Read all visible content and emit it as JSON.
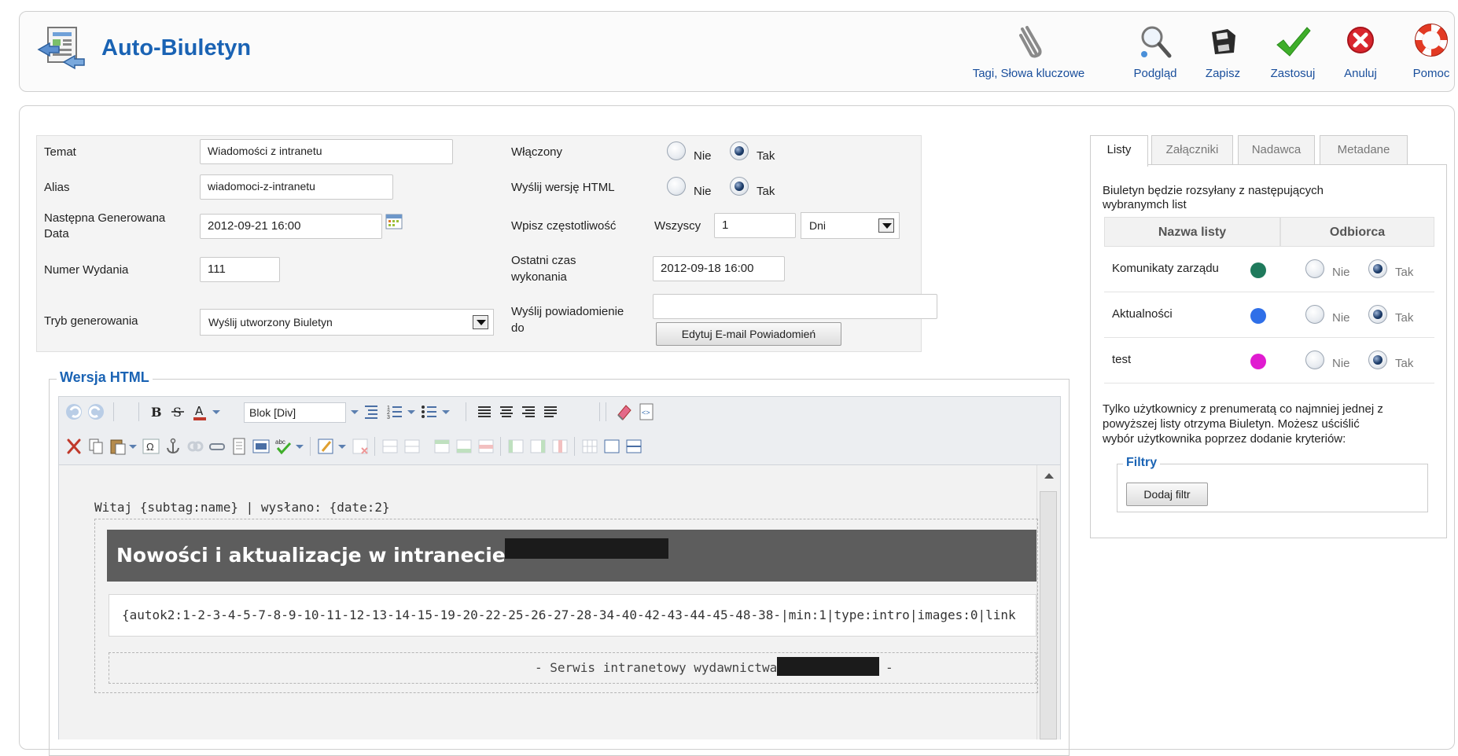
{
  "header": {
    "title": "Auto-Biuletyn",
    "icon": "newsletter-icon",
    "buttons": [
      {
        "label": "Tagi, Słowa kluczowe",
        "icon": "paperclip-icon"
      },
      {
        "label": "Podgląd",
        "icon": "magnifier-icon"
      },
      {
        "label": "Zapisz",
        "icon": "floppy-icon"
      },
      {
        "label": "Zastosuj",
        "icon": "checkmark-icon"
      },
      {
        "label": "Anuluj",
        "icon": "cancel-icon"
      },
      {
        "label": "Pomoc",
        "icon": "lifebuoy-icon"
      }
    ]
  },
  "form": {
    "temat": {
      "label": "Temat",
      "value": "Wiadomości z intranetu"
    },
    "alias": {
      "label": "Alias",
      "value": "wiadomoci-z-intranetu"
    },
    "next_date": {
      "label_1": "Następna Generowana",
      "label_2": "Data",
      "value": "2012-09-21 16:00"
    },
    "issue": {
      "label": "Numer Wydania",
      "value": "111"
    },
    "mode": {
      "label": "Tryb generowania",
      "value": "Wyślij utworzony Biuletyn"
    },
    "enabled": {
      "label": "Włączony",
      "no": "Nie",
      "yes": "Tak",
      "selected": "Tak"
    },
    "send_html": {
      "label": "Wyślij wersję HTML",
      "no": "Nie",
      "yes": "Tak",
      "selected": "Tak"
    },
    "frequency": {
      "label": "Wpisz częstotliwość",
      "prefix": "Wszyscy",
      "value": "1",
      "unit": "Dni"
    },
    "last_run": {
      "label_1": "Ostatni czas",
      "label_2": "wykonania",
      "value": "2012-09-18 16:00"
    },
    "notify": {
      "label_1": "Wyślij powiadomienie",
      "label_2": "do",
      "value": "",
      "button": "Edytuj E-mail Powiadomień"
    }
  },
  "editor": {
    "legend": "Wersja HTML",
    "format_value": "Blok [Div]",
    "greeting": "Witaj {subtag:name} | wysłano: {date:2}",
    "banner": "Nowości i aktualizacje w intranecie",
    "content": "{autok2:1-2-3-4-5-7-8-9-10-11-12-13-14-15-19-20-22-25-26-27-28-34-40-42-43-44-45-48-38-|min:1|type:intro|images:0|link",
    "footer": "- Serwis intranetowy wydawnictwa",
    "footer_end": "-"
  },
  "right": {
    "tabs": [
      "Listy",
      "Załączniki",
      "Nadawca",
      "Metadane"
    ],
    "active_tab": "Listy",
    "intro_1": "Biuletyn będzie rozsyłany z następujących",
    "intro_2": "wybranymch list",
    "col_name": "Nazwa listy",
    "col_recipient": "Odbiorca",
    "no": "Nie",
    "yes": "Tak",
    "lists": [
      {
        "name": "Komunikaty zarządu",
        "color": "#1f7a5c",
        "selected": "Tak"
      },
      {
        "name": "Aktualności",
        "color": "#2f6fe8",
        "selected": "Tak"
      },
      {
        "name": "test",
        "color": "#e01bd0",
        "selected": "Tak"
      }
    ],
    "note_1": "Tylko użytkownicy z prenumeratą co najmniej jednej z",
    "note_2": "powyższej listy otrzyma Biuletyn. Możesz uściślić",
    "note_3": "wybór użytkownika poprzez dodanie kryteriów:",
    "filters_legend": "Filtry",
    "add_filter": "Dodaj filtr"
  }
}
